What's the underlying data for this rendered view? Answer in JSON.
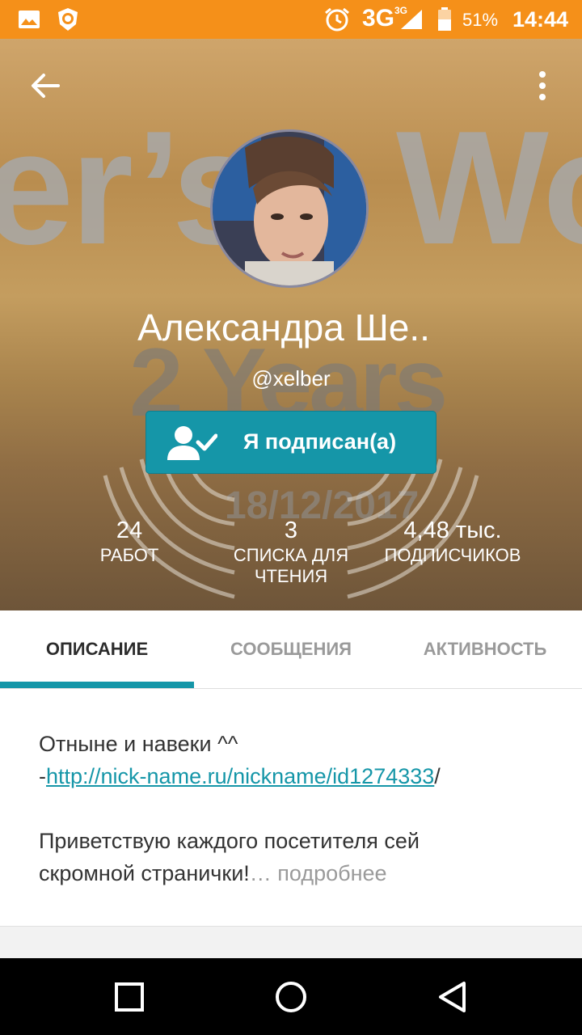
{
  "status_bar": {
    "network": "3G",
    "network_small": "3G",
    "battery": "51%",
    "time": "14:44",
    "icons": [
      "gallery-icon",
      "lion-shield-icon",
      "alarm-icon",
      "signal-icon",
      "battery-icon"
    ]
  },
  "header": {
    "background_text": {
      "line1_left": "er’s",
      "line1_right": "Wo",
      "years": "2 Years",
      "date": "18/12/2017"
    },
    "name": "Александра Ше..",
    "handle": "@xelber",
    "follow_button": {
      "label": "Я подписан(а)",
      "icon": "user-check-icon"
    },
    "stats": [
      {
        "value": "24",
        "label": "РАБОТ"
      },
      {
        "value": "3",
        "label": "СПИСКА ДЛЯ ЧТЕНИЯ"
      },
      {
        "value": "4,48 тыс.",
        "label": "ПОДПИСЧИКОВ"
      }
    ]
  },
  "tabs": {
    "items": [
      "ОПИСАНИЕ",
      "СООБЩЕНИЯ",
      "АКТИВНОСТЬ"
    ],
    "active": "ОПИСАНИЕ"
  },
  "description": {
    "line1": "Отныне и навеки ^^",
    "link_prefix": "-",
    "link": "http://nick-name.ru/nickname/id1274333",
    "link_suffix": "/",
    "para2": "Приветствую каждого посетителя сей скромной странички!",
    "ellipsis": "…",
    "more": "подробнее"
  },
  "colors": {
    "status_bar": "#f59019",
    "accent": "#1596a8"
  }
}
